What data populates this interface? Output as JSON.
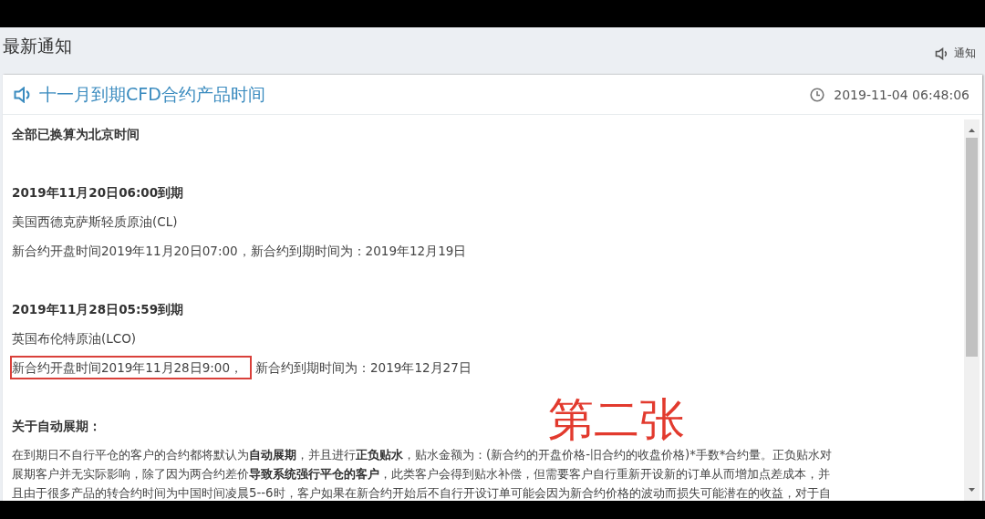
{
  "page": {
    "title": "最新通知",
    "link": "通知"
  },
  "notice": {
    "title": "十一月到期CFD合约产品时间",
    "time": "2019-11-04 06:48:06"
  },
  "sections": [
    {
      "lines": [
        {
          "kind": "heading",
          "text": "全部已换算为北京时间"
        }
      ]
    },
    {
      "lines": [
        {
          "kind": "heading",
          "text": "2019年11月20日06:00到期"
        },
        {
          "kind": "text",
          "text": "美国西德克萨斯轻质原油(CL)"
        },
        {
          "kind": "text",
          "text": "新合约开盘时间2019年11月20日07:00，新合约到期时间为：2019年12月19日"
        }
      ]
    },
    {
      "lines": [
        {
          "kind": "heading",
          "text": "2019年11月28日05:59到期"
        },
        {
          "kind": "text",
          "text": "英国布伦特原油(LCO)"
        },
        {
          "kind": "annotated",
          "parts": [
            {
              "text": "新合约开盘时间2019年11月28日9:00，",
              "boxed": true
            },
            {
              "text": "新合约到期时间为：2019年12月27日",
              "boxed": false
            }
          ]
        }
      ]
    },
    {
      "lines": [
        {
          "kind": "heading",
          "text": "关于自动展期："
        },
        {
          "kind": "paragraph",
          "rows": [
            {
              "parts": [
                {
                  "text": "在到期日不自行平仓的客户的合约都将默认为",
                  "bold": false
                },
                {
                  "text": "自动展期",
                  "bold": true
                },
                {
                  "text": "，并且进行",
                  "bold": false
                },
                {
                  "text": "正负贴水",
                  "bold": true
                },
                {
                  "text": "，贴水金额为：(新合约的开盘价格-旧合约的收盘价格)*手数*合约量。正负贴水对",
                  "bold": false
                }
              ]
            },
            {
              "parts": [
                {
                  "text": "展期客户并无实际影响，除了因为两合约差价",
                  "bold": false
                },
                {
                  "text": "导致系统强行平仓的客户",
                  "bold": true
                },
                {
                  "text": "，此类客户会得到贴水补偿，但需要客户自行重新开设新的订单从而增加点差成本，并",
                  "bold": false
                }
              ]
            },
            {
              "parts": [
                {
                  "text": "且由于很多产品的转合约时间为中国时间凌晨5--6时，客户如果在新合约开始后不自行开设订单可能会因为新合约价格的波动而损失可能潜在的收益，对于自",
                  "bold": false
                }
              ]
            }
          ]
        }
      ]
    }
  ],
  "annotation": {
    "text": "第二张"
  }
}
